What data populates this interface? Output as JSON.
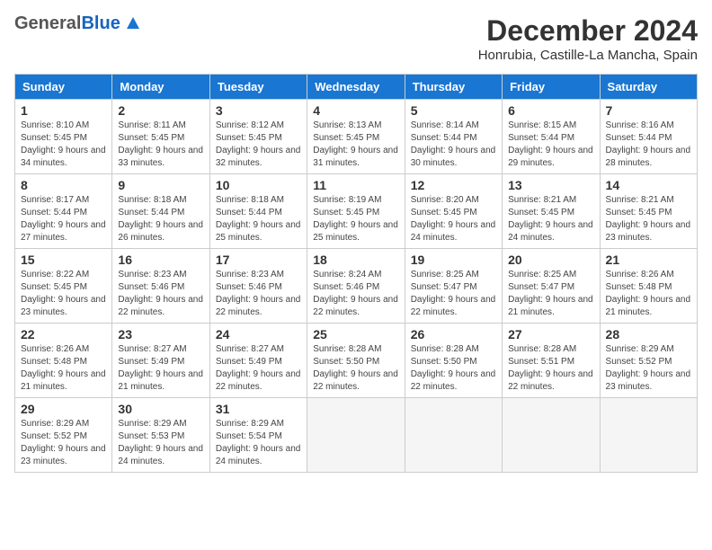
{
  "header": {
    "logo_general": "General",
    "logo_blue": "Blue",
    "title": "December 2024",
    "subtitle": "Honrubia, Castille-La Mancha, Spain"
  },
  "columns": [
    "Sunday",
    "Monday",
    "Tuesday",
    "Wednesday",
    "Thursday",
    "Friday",
    "Saturday"
  ],
  "weeks": [
    [
      {
        "day": "1",
        "sunrise": "Sunrise: 8:10 AM",
        "sunset": "Sunset: 5:45 PM",
        "daylight": "Daylight: 9 hours and 34 minutes."
      },
      {
        "day": "2",
        "sunrise": "Sunrise: 8:11 AM",
        "sunset": "Sunset: 5:45 PM",
        "daylight": "Daylight: 9 hours and 33 minutes."
      },
      {
        "day": "3",
        "sunrise": "Sunrise: 8:12 AM",
        "sunset": "Sunset: 5:45 PM",
        "daylight": "Daylight: 9 hours and 32 minutes."
      },
      {
        "day": "4",
        "sunrise": "Sunrise: 8:13 AM",
        "sunset": "Sunset: 5:45 PM",
        "daylight": "Daylight: 9 hours and 31 minutes."
      },
      {
        "day": "5",
        "sunrise": "Sunrise: 8:14 AM",
        "sunset": "Sunset: 5:44 PM",
        "daylight": "Daylight: 9 hours and 30 minutes."
      },
      {
        "day": "6",
        "sunrise": "Sunrise: 8:15 AM",
        "sunset": "Sunset: 5:44 PM",
        "daylight": "Daylight: 9 hours and 29 minutes."
      },
      {
        "day": "7",
        "sunrise": "Sunrise: 8:16 AM",
        "sunset": "Sunset: 5:44 PM",
        "daylight": "Daylight: 9 hours and 28 minutes."
      }
    ],
    [
      {
        "day": "8",
        "sunrise": "Sunrise: 8:17 AM",
        "sunset": "Sunset: 5:44 PM",
        "daylight": "Daylight: 9 hours and 27 minutes."
      },
      {
        "day": "9",
        "sunrise": "Sunrise: 8:18 AM",
        "sunset": "Sunset: 5:44 PM",
        "daylight": "Daylight: 9 hours and 26 minutes."
      },
      {
        "day": "10",
        "sunrise": "Sunrise: 8:18 AM",
        "sunset": "Sunset: 5:44 PM",
        "daylight": "Daylight: 9 hours and 25 minutes."
      },
      {
        "day": "11",
        "sunrise": "Sunrise: 8:19 AM",
        "sunset": "Sunset: 5:45 PM",
        "daylight": "Daylight: 9 hours and 25 minutes."
      },
      {
        "day": "12",
        "sunrise": "Sunrise: 8:20 AM",
        "sunset": "Sunset: 5:45 PM",
        "daylight": "Daylight: 9 hours and 24 minutes."
      },
      {
        "day": "13",
        "sunrise": "Sunrise: 8:21 AM",
        "sunset": "Sunset: 5:45 PM",
        "daylight": "Daylight: 9 hours and 24 minutes."
      },
      {
        "day": "14",
        "sunrise": "Sunrise: 8:21 AM",
        "sunset": "Sunset: 5:45 PM",
        "daylight": "Daylight: 9 hours and 23 minutes."
      }
    ],
    [
      {
        "day": "15",
        "sunrise": "Sunrise: 8:22 AM",
        "sunset": "Sunset: 5:45 PM",
        "daylight": "Daylight: 9 hours and 23 minutes."
      },
      {
        "day": "16",
        "sunrise": "Sunrise: 8:23 AM",
        "sunset": "Sunset: 5:46 PM",
        "daylight": "Daylight: 9 hours and 22 minutes."
      },
      {
        "day": "17",
        "sunrise": "Sunrise: 8:23 AM",
        "sunset": "Sunset: 5:46 PM",
        "daylight": "Daylight: 9 hours and 22 minutes."
      },
      {
        "day": "18",
        "sunrise": "Sunrise: 8:24 AM",
        "sunset": "Sunset: 5:46 PM",
        "daylight": "Daylight: 9 hours and 22 minutes."
      },
      {
        "day": "19",
        "sunrise": "Sunrise: 8:25 AM",
        "sunset": "Sunset: 5:47 PM",
        "daylight": "Daylight: 9 hours and 22 minutes."
      },
      {
        "day": "20",
        "sunrise": "Sunrise: 8:25 AM",
        "sunset": "Sunset: 5:47 PM",
        "daylight": "Daylight: 9 hours and 21 minutes."
      },
      {
        "day": "21",
        "sunrise": "Sunrise: 8:26 AM",
        "sunset": "Sunset: 5:48 PM",
        "daylight": "Daylight: 9 hours and 21 minutes."
      }
    ],
    [
      {
        "day": "22",
        "sunrise": "Sunrise: 8:26 AM",
        "sunset": "Sunset: 5:48 PM",
        "daylight": "Daylight: 9 hours and 21 minutes."
      },
      {
        "day": "23",
        "sunrise": "Sunrise: 8:27 AM",
        "sunset": "Sunset: 5:49 PM",
        "daylight": "Daylight: 9 hours and 21 minutes."
      },
      {
        "day": "24",
        "sunrise": "Sunrise: 8:27 AM",
        "sunset": "Sunset: 5:49 PM",
        "daylight": "Daylight: 9 hours and 22 minutes."
      },
      {
        "day": "25",
        "sunrise": "Sunrise: 8:28 AM",
        "sunset": "Sunset: 5:50 PM",
        "daylight": "Daylight: 9 hours and 22 minutes."
      },
      {
        "day": "26",
        "sunrise": "Sunrise: 8:28 AM",
        "sunset": "Sunset: 5:50 PM",
        "daylight": "Daylight: 9 hours and 22 minutes."
      },
      {
        "day": "27",
        "sunrise": "Sunrise: 8:28 AM",
        "sunset": "Sunset: 5:51 PM",
        "daylight": "Daylight: 9 hours and 22 minutes."
      },
      {
        "day": "28",
        "sunrise": "Sunrise: 8:29 AM",
        "sunset": "Sunset: 5:52 PM",
        "daylight": "Daylight: 9 hours and 23 minutes."
      }
    ],
    [
      {
        "day": "29",
        "sunrise": "Sunrise: 8:29 AM",
        "sunset": "Sunset: 5:52 PM",
        "daylight": "Daylight: 9 hours and 23 minutes."
      },
      {
        "day": "30",
        "sunrise": "Sunrise: 8:29 AM",
        "sunset": "Sunset: 5:53 PM",
        "daylight": "Daylight: 9 hours and 24 minutes."
      },
      {
        "day": "31",
        "sunrise": "Sunrise: 8:29 AM",
        "sunset": "Sunset: 5:54 PM",
        "daylight": "Daylight: 9 hours and 24 minutes."
      },
      null,
      null,
      null,
      null
    ]
  ]
}
